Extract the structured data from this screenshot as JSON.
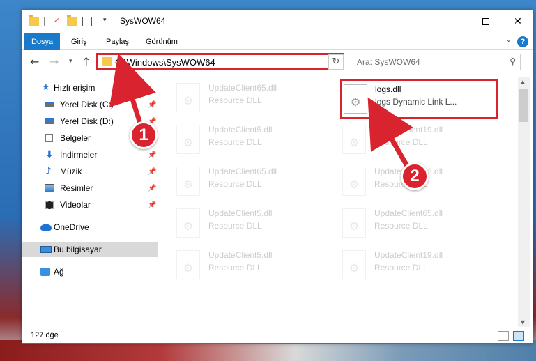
{
  "window": {
    "title": "SysWOW64",
    "controls": {
      "minimize": "—",
      "maximize": "☐",
      "close": "✕"
    }
  },
  "quick_access": {
    "dropdown": "▾"
  },
  "ribbon": {
    "tabs": [
      {
        "label": "Dosya",
        "active": true
      },
      {
        "label": "Giriş"
      },
      {
        "label": "Paylaş"
      },
      {
        "label": "Görünüm"
      }
    ],
    "help": "?",
    "chevron": "⌄"
  },
  "nav": {
    "back": "←",
    "forward": "→",
    "recent": "▾",
    "up": "↑",
    "address": "C:\\Windows\\SysWOW64",
    "address_chevron": "⌄",
    "refresh": "↻",
    "search_placeholder": "Ara: SysWOW64",
    "search_icon": "⚲"
  },
  "sidebar": {
    "items": [
      {
        "label": "Hızlı erişim",
        "icon": "star-icon"
      },
      {
        "label": "Yerel Disk (C:)",
        "icon": "disk-icon",
        "pinned": true
      },
      {
        "label": "Yerel Disk (D:)",
        "icon": "disk-icon",
        "pinned": true
      },
      {
        "label": "Belgeler",
        "icon": "documents-icon",
        "pinned": true
      },
      {
        "label": "İndirmeler",
        "icon": "download-icon",
        "pinned": true
      },
      {
        "label": "Müzik",
        "icon": "music-icon",
        "pinned": true
      },
      {
        "label": "Resimler",
        "icon": "pictures-icon",
        "pinned": true
      },
      {
        "label": "Videolar",
        "icon": "videos-icon",
        "pinned": true
      },
      {
        "label": "OneDrive",
        "icon": "onedrive-icon"
      },
      {
        "label": "Bu bilgisayar",
        "icon": "computer-icon",
        "selected": true
      },
      {
        "label": "Ağ",
        "icon": "network-icon"
      }
    ],
    "pin_glyph": "📌"
  },
  "files": [
    {
      "name": "UpdateClient65.dll",
      "desc": "Resource DLL"
    },
    {
      "name": "logs.dll",
      "desc": "logs Dynamic Link L...",
      "highlighted": true
    },
    {
      "name": "UpdateClient5.dll",
      "desc": "Resource DLL"
    },
    {
      "name": "UpdateClient19.dll",
      "desc": "Resource DLL"
    },
    {
      "name": "UpdateClient65.dll",
      "desc": "Resource DLL"
    },
    {
      "name": "UpdateClient63.dll",
      "desc": "Resource DLL"
    },
    {
      "name": "UpdateClient5.dll",
      "desc": "Resource DLL"
    },
    {
      "name": "UpdateClient65.dll",
      "desc": "Resource DLL"
    },
    {
      "name": "UpdateClient5.dll",
      "desc": "Resource DLL"
    },
    {
      "name": "UpdateClient19.dll",
      "desc": "Resource DLL"
    }
  ],
  "gear_glyph": "⚙",
  "status": {
    "item_count": "127 öğe"
  },
  "scrollbar": {
    "up": "▲",
    "down": "▼"
  },
  "callouts": [
    {
      "number": "1"
    },
    {
      "number": "2"
    }
  ],
  "colors": {
    "accent": "#1979ca",
    "highlight_red": "#d9232f"
  }
}
